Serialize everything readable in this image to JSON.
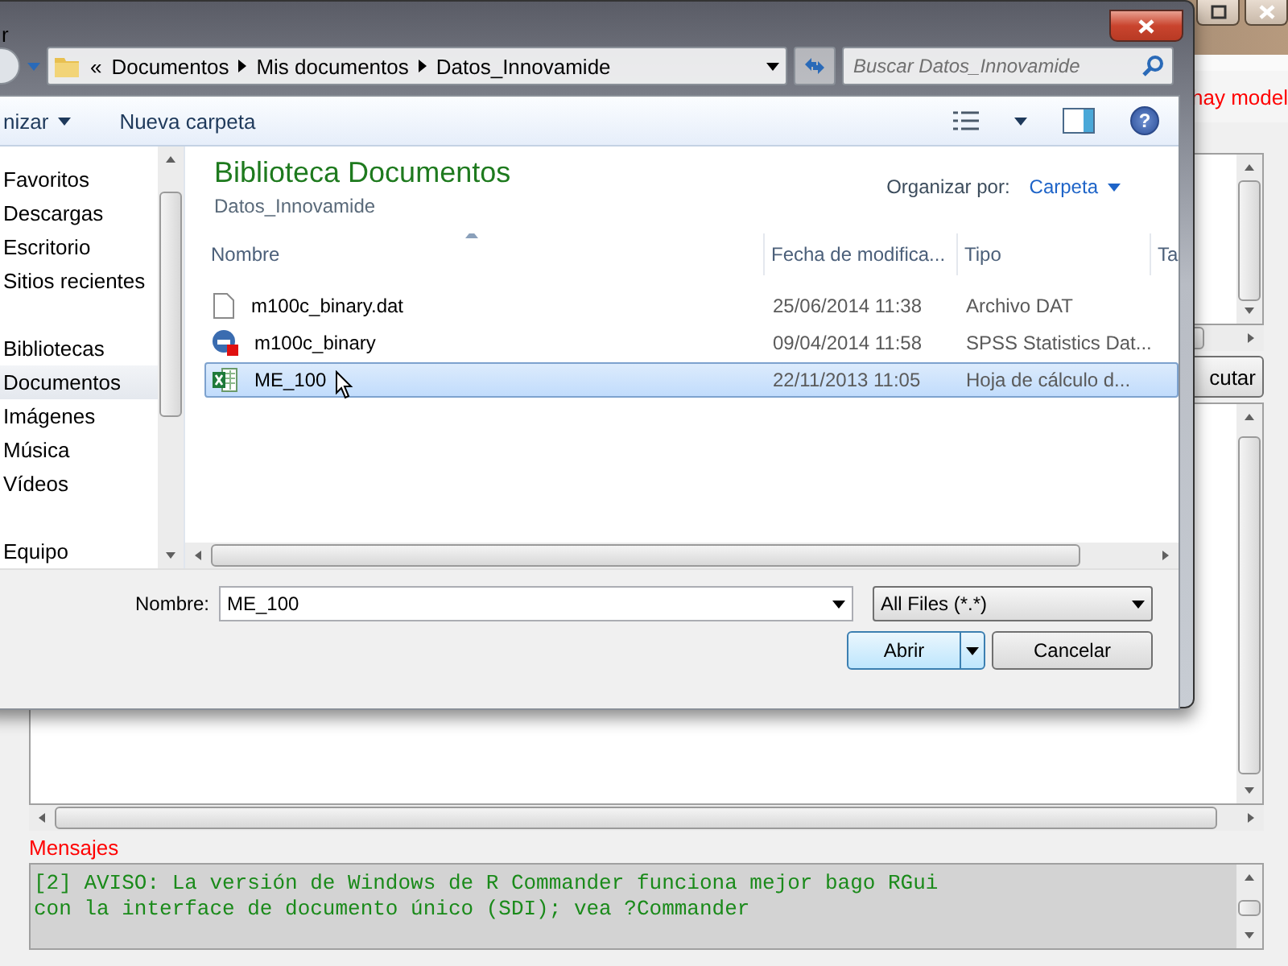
{
  "rcmdr": {
    "warning": "hay model",
    "run_button": "cutar",
    "messages_label": "Mensajes",
    "messages": [
      "[2] AVISO: La versión de Windows de R Commander funciona mejor bago RGui",
      "con la interface de documento único (SDI); vea ?Commander"
    ]
  },
  "dialog": {
    "title": "r",
    "breadcrumb": {
      "overflow": "«",
      "parts": [
        "Documentos",
        "Mis documentos",
        "Datos_Innovamide"
      ]
    },
    "search": {
      "placeholder": "Buscar Datos_Innovamide"
    },
    "toolbar": {
      "organize": "nizar",
      "new_folder": "Nueva carpeta",
      "help": "?"
    },
    "nav": [
      {
        "label": "Favoritos",
        "kind": "section",
        "selected": false
      },
      {
        "label": "Descargas",
        "kind": "item",
        "selected": false
      },
      {
        "label": "Escritorio",
        "kind": "item",
        "selected": false
      },
      {
        "label": "Sitios recientes",
        "kind": "item",
        "selected": false
      },
      {
        "label": "Bibliotecas",
        "kind": "section",
        "selected": false
      },
      {
        "label": "Documentos",
        "kind": "item",
        "selected": true
      },
      {
        "label": "Imágenes",
        "kind": "item",
        "selected": false
      },
      {
        "label": "Música",
        "kind": "item",
        "selected": false
      },
      {
        "label": "Vídeos",
        "kind": "item",
        "selected": false
      },
      {
        "label": "Equipo",
        "kind": "section",
        "selected": false
      }
    ],
    "library": {
      "title": "Biblioteca Documentos",
      "subtitle": "Datos_Innovamide",
      "arrange_label": "Organizar por:",
      "arrange_value": "Carpeta"
    },
    "columns": [
      "Nombre",
      "Fecha de modifica...",
      "Tipo",
      "Ta"
    ],
    "files": [
      {
        "name": "m100c_binary.dat",
        "date": "25/06/2014 11:38",
        "type": "Archivo DAT",
        "kind": "dat",
        "selected": false
      },
      {
        "name": "m100c_binary",
        "date": "09/04/2014 11:58",
        "type": "SPSS Statistics Dat...",
        "kind": "spss",
        "selected": false
      },
      {
        "name": "ME_100",
        "date": "22/11/2013 11:05",
        "type": "Hoja de cálculo d...",
        "kind": "excel",
        "selected": true
      }
    ],
    "filename_label": "Nombre:",
    "filename": "ME_100",
    "filter": "All Files (*.*)",
    "open_button": "Abrir",
    "cancel_button": "Cancelar"
  }
}
